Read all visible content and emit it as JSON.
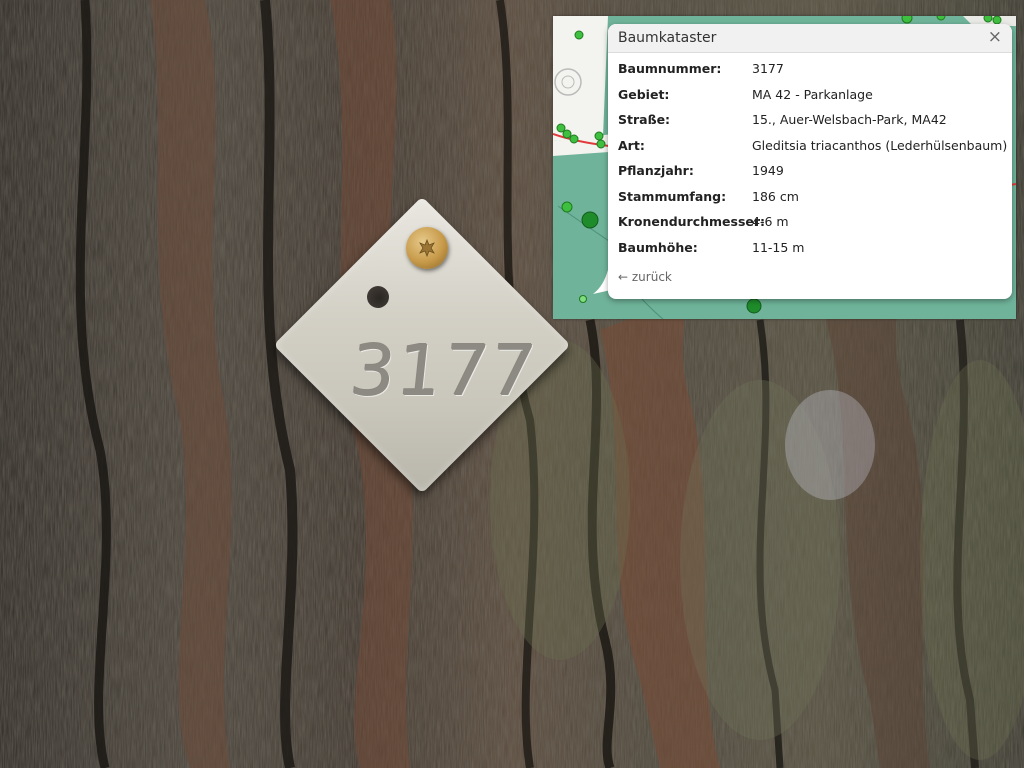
{
  "tag": {
    "number": "3177"
  },
  "popup": {
    "title": "Baumkataster",
    "close_icon": "close-icon",
    "close_glyph": "×",
    "rows": [
      {
        "key": "Baumnummer:",
        "value": "3177"
      },
      {
        "key": "Gebiet:",
        "value": "MA 42 - Parkanlage"
      },
      {
        "key": "Straße:",
        "value": "15., Auer-Welsbach-Park, MA42"
      },
      {
        "key": "Art:",
        "value": "Gleditsia triacanthos (Lederhülsenbaum)"
      },
      {
        "key": "Pflanzjahr:",
        "value": "1949"
      },
      {
        "key": "Stammumfang:",
        "value": "186 cm"
      },
      {
        "key": "Kronendurchmesser:",
        "value": "4-6 m"
      },
      {
        "key": "Baumhöhe:",
        "value": "11-15 m"
      }
    ],
    "back_label": "← zurück"
  },
  "colors": {
    "map_green": "#6fb39a",
    "tree_marker": "#3fbf3f",
    "tree_marker_dark": "#1f7a1f",
    "street_line": "#e03a3a",
    "popup_bg": "#ffffff"
  }
}
